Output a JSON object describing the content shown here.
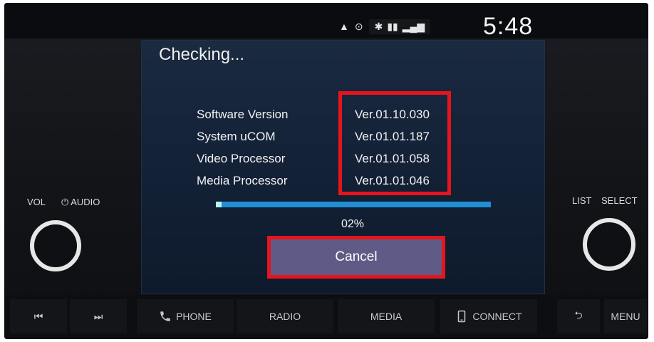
{
  "status": {
    "time": "5:48",
    "icons": [
      "navigation-icon",
      "play-icon",
      "bluetooth-icon",
      "battery-icon",
      "signal-icon"
    ]
  },
  "dialog": {
    "title": "Checking...",
    "versions": [
      {
        "label": "Software Version",
        "value": "Ver.01.10.030"
      },
      {
        "label": "System uCOM",
        "value": "Ver.01.01.187"
      },
      {
        "label": "Video Processor",
        "value": "Ver.01.01.058"
      },
      {
        "label": "Media Processor",
        "value": "Ver.01.01.046"
      }
    ],
    "progress_percent": 2,
    "progress_label": "02%",
    "cancel_label": "Cancel"
  },
  "left_panel": {
    "vol_label": "VOL",
    "audio_label": "AUDIO"
  },
  "right_panel": {
    "list_label": "LIST",
    "select_label": "SELECT"
  },
  "bottom_bar": {
    "phone_label": "PHONE",
    "radio_label": "RADIO",
    "media_label": "MEDIA",
    "connect_label": "CONNECT",
    "menu_label": "MENU"
  },
  "colors": {
    "highlight_red": "#e8141c",
    "progress_blue": "#1f8fd6",
    "progress_fill": "#b5f3ff",
    "cancel_bg": "#5f5b86"
  }
}
